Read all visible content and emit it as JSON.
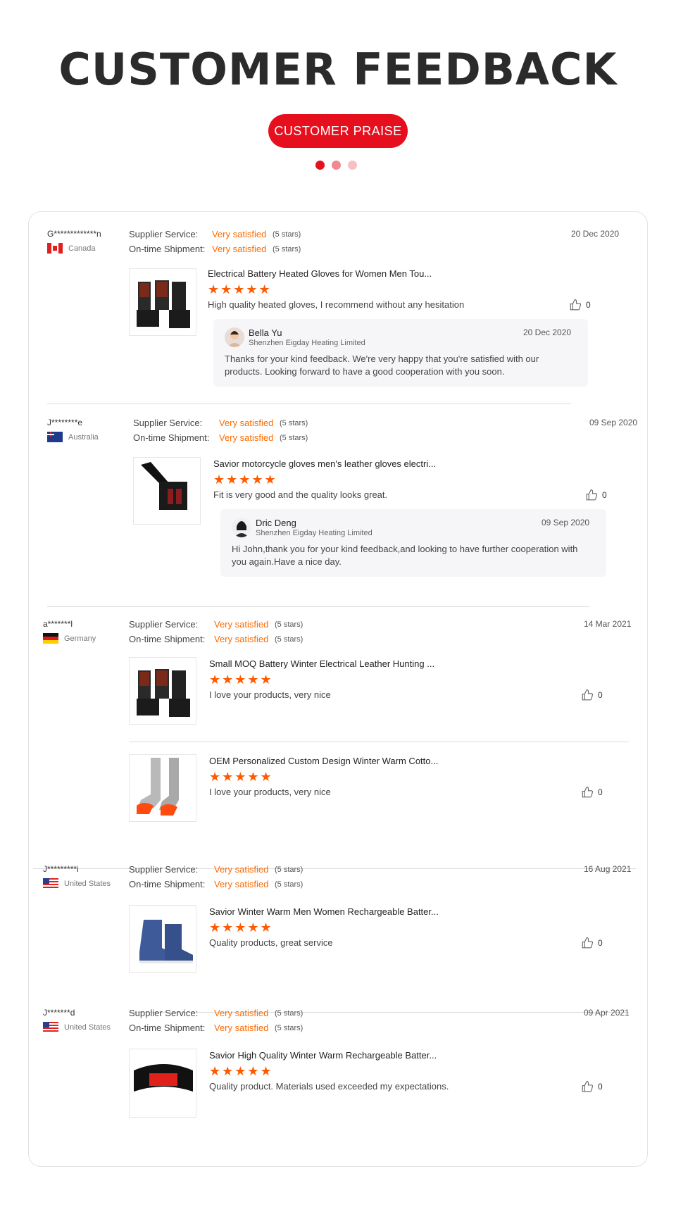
{
  "header": {
    "title": "CUSTOMER FEEDBACK",
    "pill_label": "CUSTOMER PRAISE"
  },
  "labels": {
    "supplier_service": "Supplier Service:",
    "ontime_shipment": "On-time Shipment:",
    "very_satisfied": "Very satisfied",
    "five_stars": "(5 stars)",
    "stars_glyph": "★★★★★"
  },
  "colors": {
    "accent": "#e60f1e",
    "satisfied": "#ff6a00",
    "stars": "#ff5a00"
  },
  "reviews": [
    {
      "user": "G*************n",
      "country": "Canada",
      "date": "20 Dec 2020",
      "items": [
        {
          "title": "Electrical Battery Heated Gloves for Women Men Tou...",
          "text": "High quality heated gloves,  I recommend without any hesitation",
          "likes": "0"
        }
      ],
      "reply": {
        "name": "Bella Yu",
        "company": "Shenzhen Eigday Heating Limited",
        "date": "20 Dec 2020",
        "body": "Thanks for your kind feedback. We're very happy that you're satisfied with our products. Looking forward to have a good cooperation with you soon."
      }
    },
    {
      "user": "J********e",
      "country": "Australia",
      "date": "09 Sep 2020",
      "items": [
        {
          "title": "Savior motorcycle gloves men's leather gloves electri...",
          "text": "Fit is very good and the quality looks great.",
          "likes": "0"
        }
      ],
      "reply": {
        "name": "Dric Deng",
        "company": "Shenzhen Eigday Heating Limited",
        "date": "09 Sep 2020",
        "body": "Hi John,thank you for your kind feedback,and looking to have further cooperation with you again.Have a nice day."
      }
    },
    {
      "user": "a*******l",
      "country": "Germany",
      "date": "14 Mar 2021",
      "items": [
        {
          "title": "Small MOQ Battery Winter Electrical Leather Hunting ...",
          "text": "I love your products,   very nice",
          "likes": "0"
        },
        {
          "title": "OEM Personalized Custom Design Winter Warm Cotto...",
          "text": "I love your products,   very nice",
          "likes": "0"
        }
      ]
    },
    {
      "user": "J*********i",
      "country": "United States",
      "date": "16 Aug 2021",
      "items": [
        {
          "title": "Savior Winter Warm Men Women Rechargeable Batter...",
          "text": "Quality products, great service",
          "likes": "0"
        }
      ]
    },
    {
      "user": "J*******d",
      "country": "United States",
      "date": "09 Apr 2021",
      "items": [
        {
          "title": "Savior High Quality Winter Warm Rechargeable Batter...",
          "text": "Quality product. Materials used exceeded my expectations.",
          "likes": "0"
        }
      ]
    }
  ]
}
